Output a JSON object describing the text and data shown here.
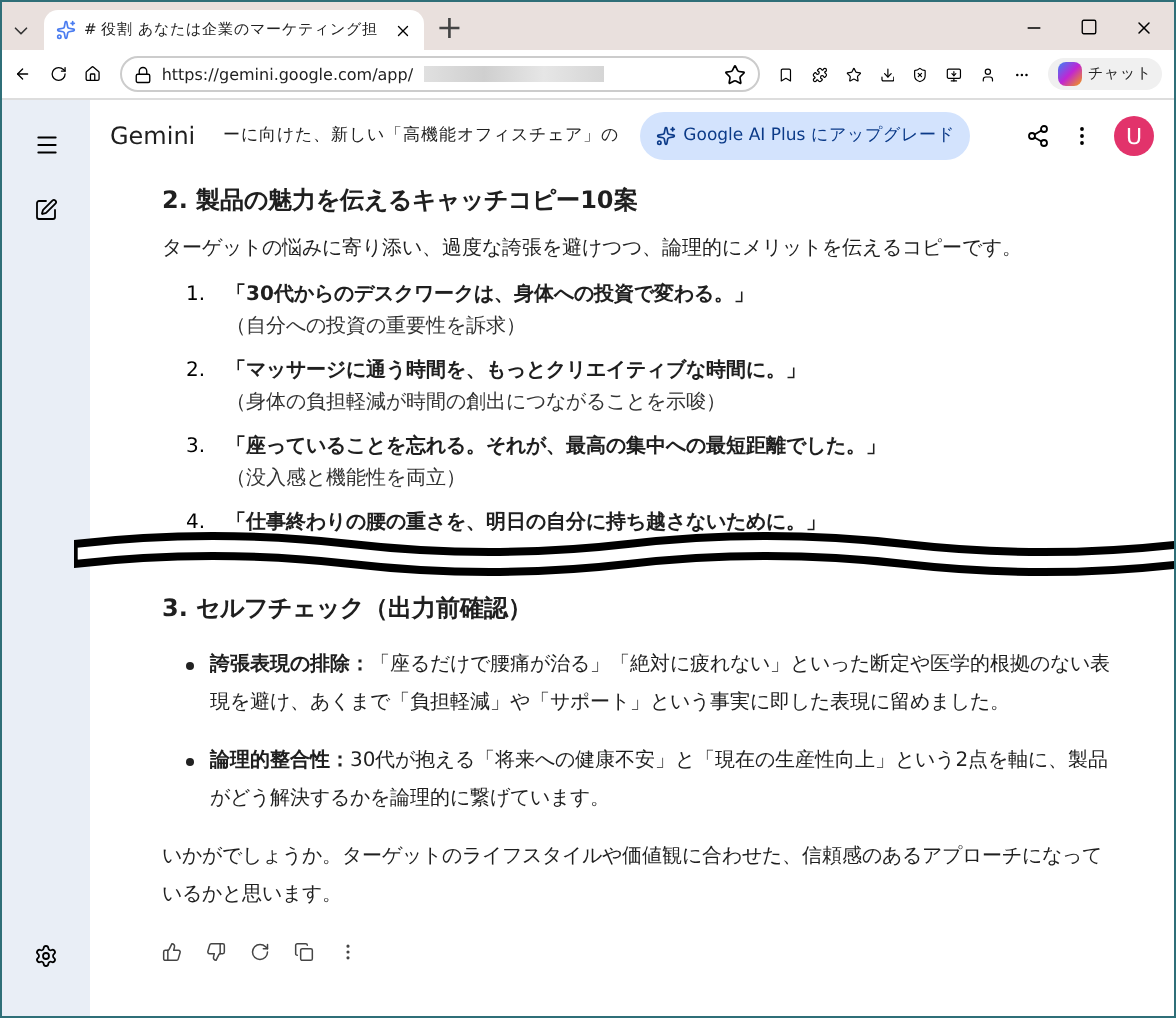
{
  "browser": {
    "tab": {
      "title": "# 役割 あなたは企業のマーケティング担",
      "selected": true
    },
    "new_tab": "+",
    "url": "https://gemini.google.com/app/",
    "copilot_label": "チャット"
  },
  "app": {
    "name": "Gemini",
    "conversation_title": "ーに向けた、新しい「高機能オフィスチェア」の",
    "upgrade_button": "Google AI Plus にアップグレード",
    "avatar": "U"
  },
  "section2": {
    "heading": "2. 製品の魅力を伝えるキャッチコピー10案",
    "intro": "ターゲットの悩みに寄り添い、過度な誇張を避けつつ、論理的にメリットを伝えるコピーです。",
    "items": [
      {
        "number": "1.",
        "copy": "「30代からのデスクワークは、身体への投資で変わる。」",
        "note": "（自分への投資の重要性を訴求）"
      },
      {
        "number": "2.",
        "copy": "「マッサージに通う時間を、もっとクリエイティブな時間に。」",
        "note": "（身体の負担軽減が時間の創出につながることを示唆）"
      },
      {
        "number": "3.",
        "copy": "「座っていることを忘れる。それが、最高の集中への最短距離でした。」",
        "note": "（没入感と機能性を両立）"
      },
      {
        "number": "4.",
        "copy": "「仕事終わりの腰の重さを、明日の自分に持ち越さないために。」"
      }
    ]
  },
  "section3": {
    "heading": "3. セルフチェック（出力前確認）",
    "bullets": [
      {
        "term": "誇張表現の排除：",
        "text": "「座るだけで腰痛が治る」「絶対に疲れない」といった断定や医学的根拠のない表現を避け、あくまで「負担軽減」や「サポート」という事実に即した表現に留めました。"
      },
      {
        "term": "論理的整合性：",
        "text": "30代が抱える「将来への健康不安」と「現在の生産性向上」という2点を軸に、製品がどう解決するかを論理的に繋げています。"
      }
    ]
  },
  "closing": "いかがでしょうか。ターゲットのライフスタイルや価値観に合わせた、信頼感のあるアプローチになっているかと思います。"
}
